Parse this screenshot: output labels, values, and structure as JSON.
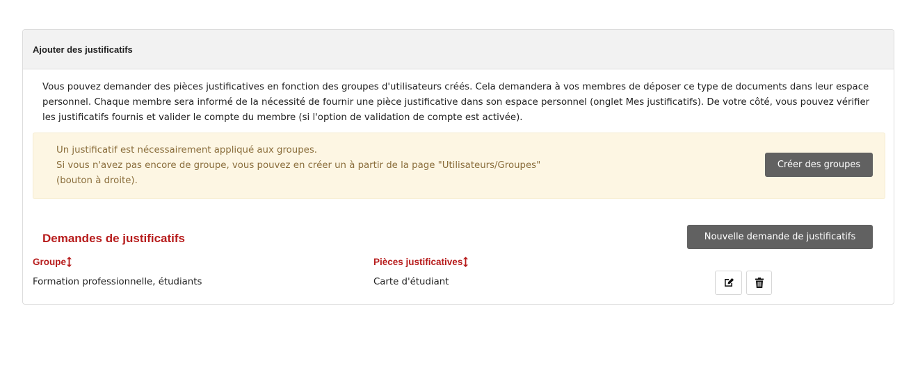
{
  "panel": {
    "title": "Ajouter des justificatifs",
    "intro": "Vous pouvez demander des pièces justificatives en fonction des groupes d'utilisateurs créés. Cela demandera à vos membres de déposer ce type de documents dans leur espace personnel. Chaque membre sera informé de la nécessité de fournir une pièce justificative dans son espace personnel (onglet Mes justificatifs). De votre côté, vous pouvez vérifier les justificatifs fournis et valider le compte du membre (si l'option de validation de compte est activée)."
  },
  "alert": {
    "line1": "Un justificatif est nécessairement appliqué aux groupes.",
    "line2": "Si vous n'avez pas encore de groupe, vous pouvez en créer un à partir de la page \"Utilisateurs/Groupes\"",
    "line3": "(bouton à droite).",
    "button": "Créer des groupes"
  },
  "requests": {
    "title": "Demandes de justificatifs",
    "new_button": "Nouvelle demande de justificatifs",
    "columns": [
      "Groupe",
      "Pièces justificatives"
    ],
    "rows": [
      {
        "group": "Formation professionnelle, étudiants",
        "documents": "Carte d'étudiant"
      }
    ]
  },
  "icons": {
    "sort": "sort-icon",
    "edit": "edit-icon",
    "delete": "trash-icon"
  },
  "colors": {
    "accent_red": "#b71c1c",
    "button_dark": "#616161",
    "alert_bg": "#fdf6e3",
    "alert_text": "#8a6d3b"
  }
}
